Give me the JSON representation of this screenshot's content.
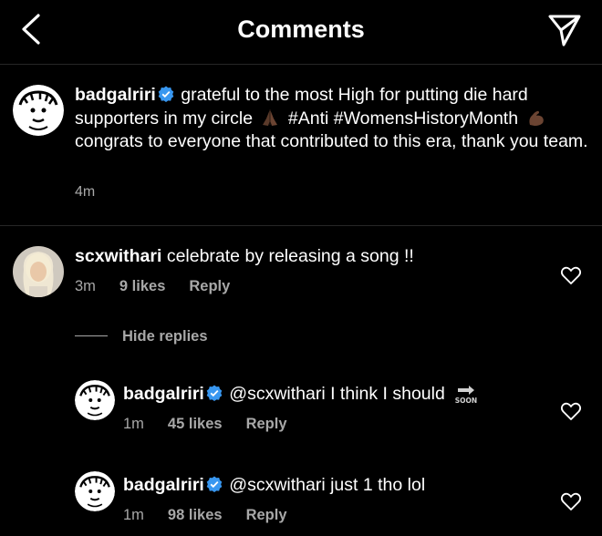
{
  "header": {
    "title": "Comments"
  },
  "caption": {
    "username": "badgalriri",
    "text_1": "grateful to the most High for putting die hard supporters in my circle",
    "hashtags": "#Anti #WomensHistoryMonth",
    "text_2": "congrats to everyone that contributed to this era, thank you team.",
    "time": "4m"
  },
  "comments": [
    {
      "username": "scxwithari",
      "text": "celebrate by releasing a song !!",
      "time": "3m",
      "likes": "9 likes",
      "reply": "Reply"
    }
  ],
  "hide_replies": "Hide replies",
  "replies": [
    {
      "username": "badgalriri",
      "text": "@scxwithari I think I should",
      "soon": "SOON",
      "time": "1m",
      "likes": "45 likes",
      "reply": "Reply"
    },
    {
      "username": "badgalriri",
      "text": "@scxwithari just 1 tho lol",
      "time": "1m",
      "likes": "98 likes",
      "reply": "Reply"
    }
  ],
  "icons": {
    "back": "chevron-left-icon",
    "send": "paper-plane-icon",
    "heart": "heart-outline-icon",
    "verified": "verified-badge-icon"
  },
  "colors": {
    "background": "#000000",
    "text": "#ffffff",
    "muted": "#a8a8a8",
    "verified": "#3897f0"
  }
}
